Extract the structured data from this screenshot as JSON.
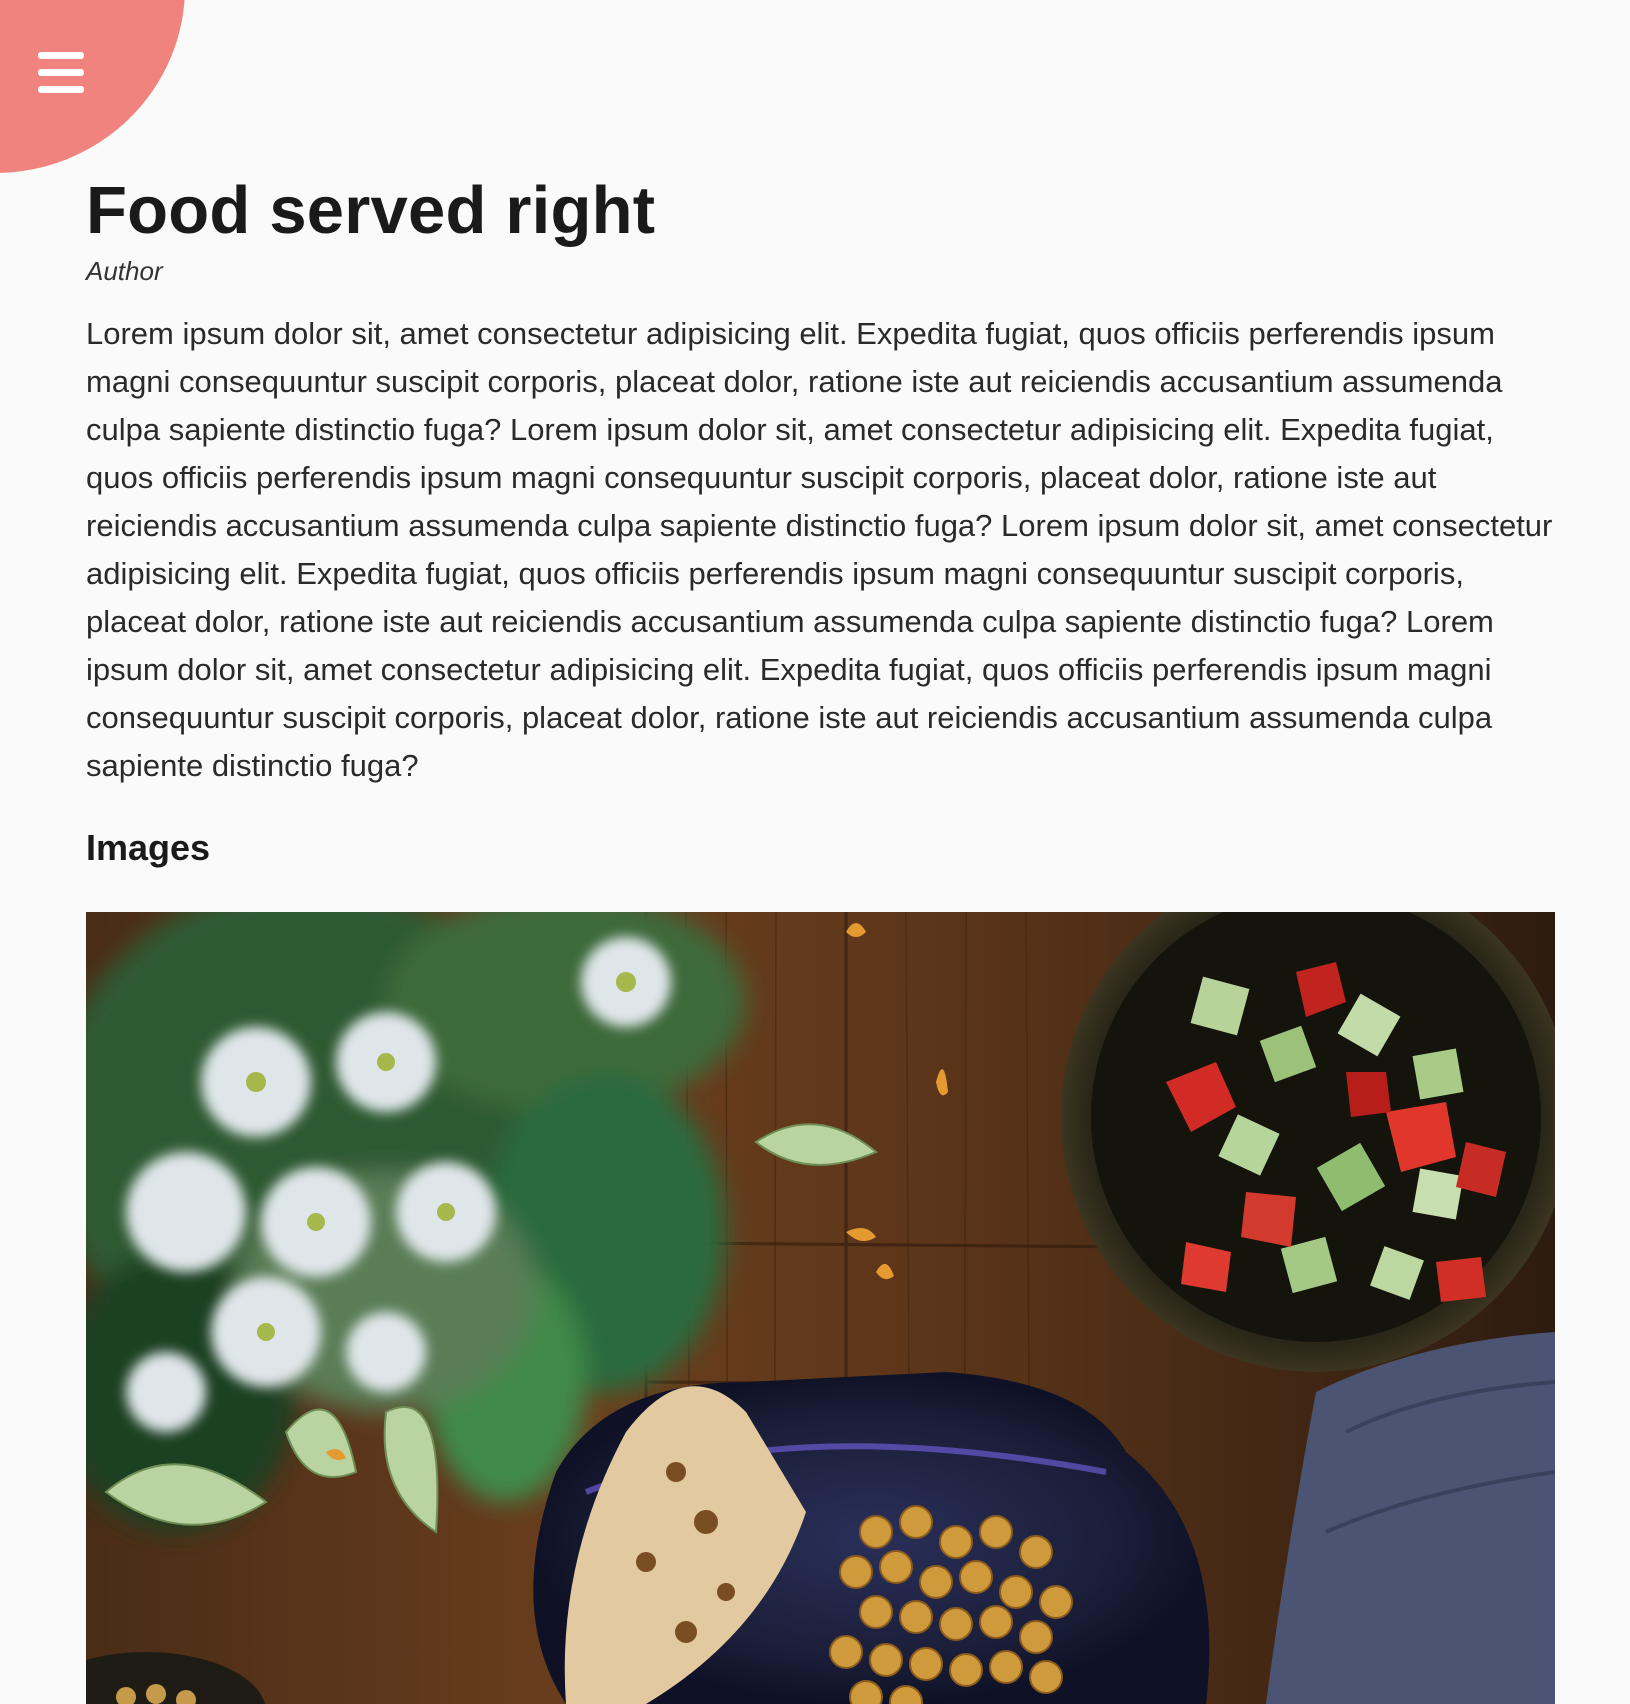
{
  "header": {
    "menu_icon": "hamburger-menu-icon",
    "accent_color": "#f0837d"
  },
  "article": {
    "title": "Food served right",
    "author": "Author",
    "body": "Lorem ipsum dolor sit, amet consectetur adipisicing elit. Expedita fugiat, quos officiis perferendis ipsum magni consequuntur suscipit corporis, placeat dolor, ratione iste aut reiciendis accusantium assumenda culpa sapiente distinctio fuga? Lorem ipsum dolor sit, amet consectetur adipisicing elit. Expedita fugiat, quos officiis perferendis ipsum magni consequuntur suscipit corporis, placeat dolor, ratione iste aut reiciendis accusantium assumenda culpa sapiente distinctio fuga? Lorem ipsum dolor sit, amet consectetur adipisicing elit. Expedita fugiat, quos officiis perferendis ipsum magni consequuntur suscipit corporis, placeat dolor, ratione iste aut reiciendis accusantium assumenda culpa sapiente distinctio fuga? Lorem ipsum dolor sit, amet consectetur adipisicing elit. Expedita fugiat, quos officiis perferendis ipsum magni consequuntur suscipit corporis, placeat dolor, ratione iste aut reiciendis accusantium assumenda culpa sapiente distinctio fuga?",
    "images_heading": "Images"
  }
}
